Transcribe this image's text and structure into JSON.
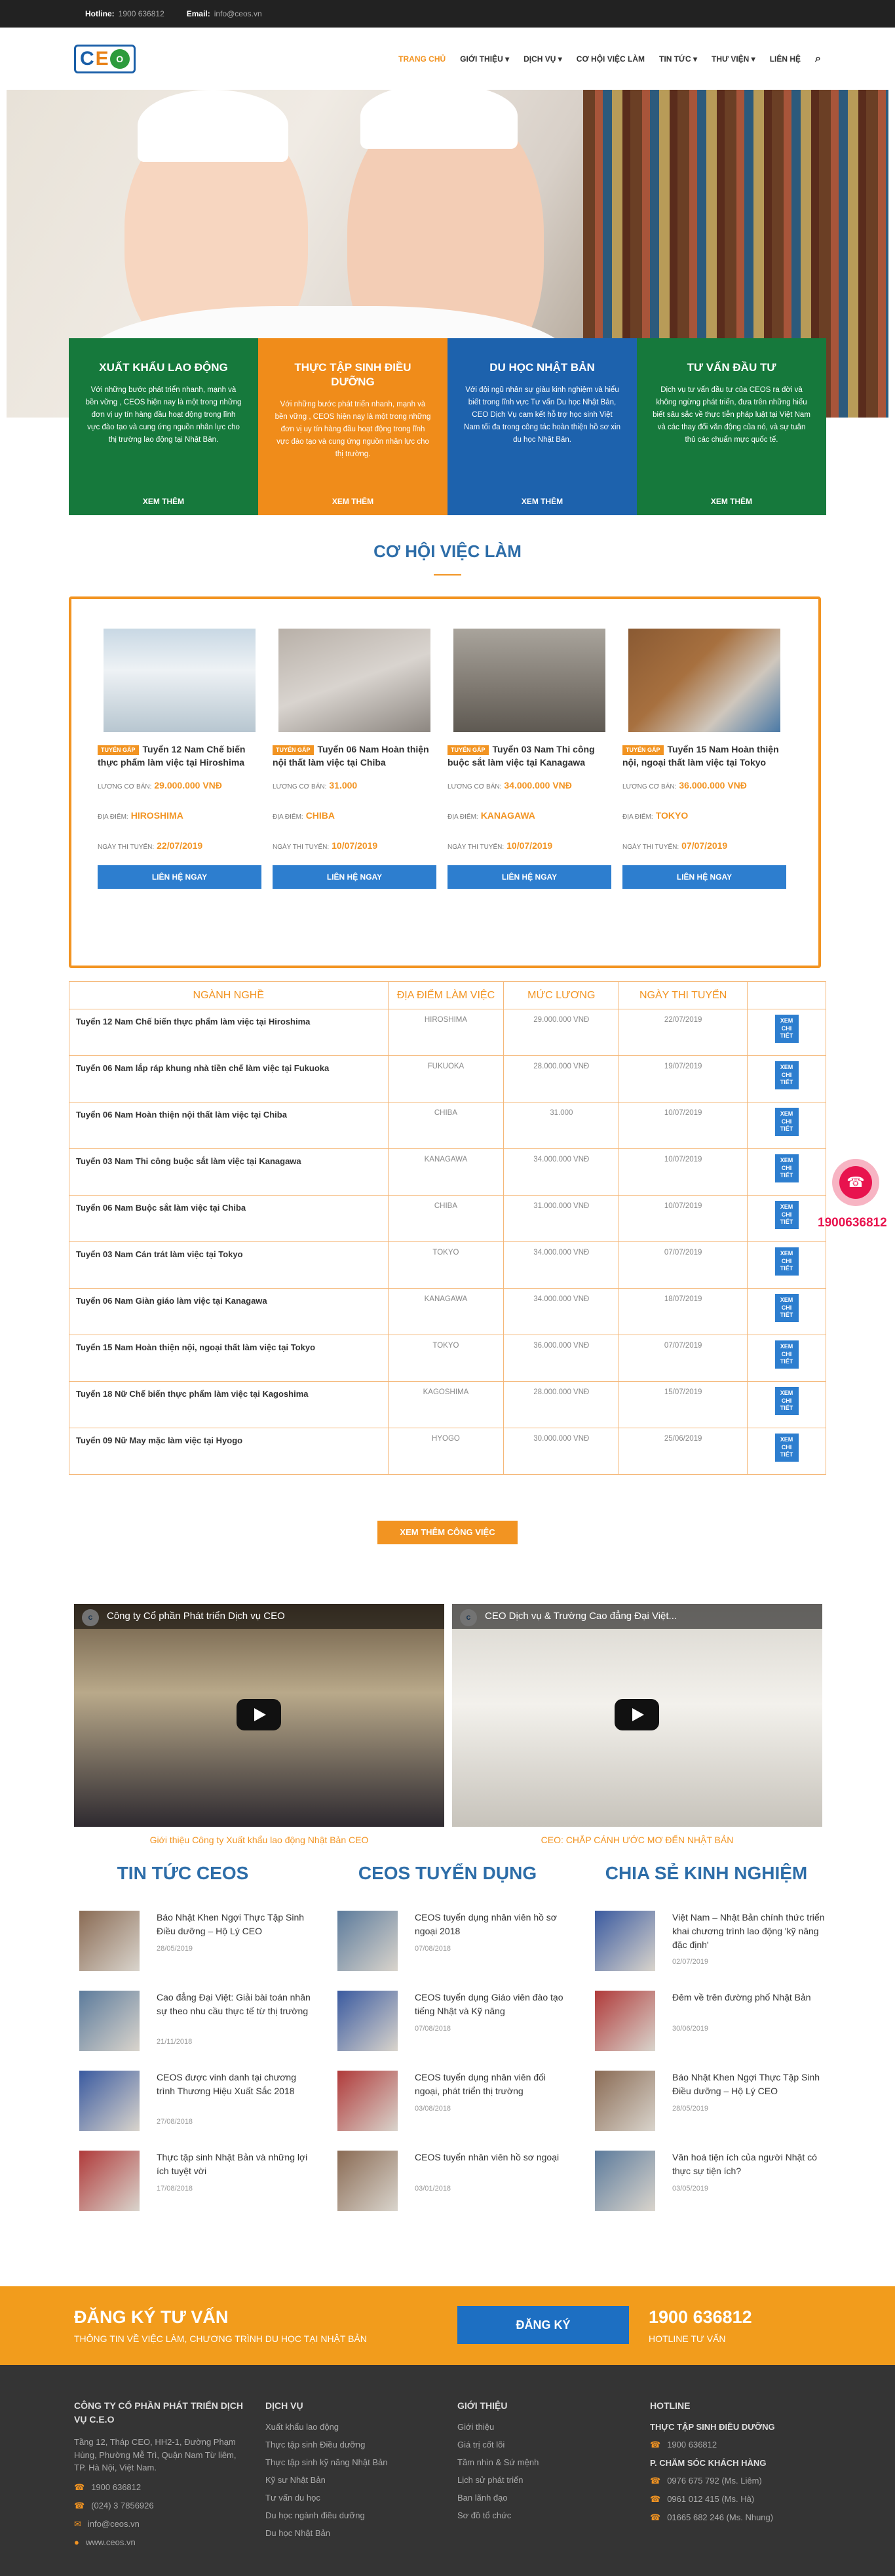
{
  "topbar": {
    "hotline_label": "Hotline:",
    "hotline": "1900 636812",
    "email_label": "Email:",
    "email": "info@ceos.vn"
  },
  "logo": {
    "text_left": "C",
    "text_mid": "E",
    "text_right": "O"
  },
  "nav": {
    "items": [
      "TRANG CHỦ",
      "GIỚI THIỆU ▾",
      "DỊCH VỤ ▾",
      "CƠ HỘI VIỆC LÀM",
      "TIN TỨC ▾",
      "THƯ VIỆN ▾",
      "LIÊN HỆ"
    ],
    "search_icon": "⌕"
  },
  "services": [
    {
      "title": "XUẤT KHẨU LAO ĐỘNG",
      "desc": "Với những bước phát triển nhanh, mạnh và bền vững , CEOS hiện nay là một trong những đơn vị uy tín hàng đầu hoạt động trong lĩnh vực đào tạo và cung ứng nguồn nhân lực cho thị trường lao động tại Nhật Bản.",
      "more": "XEM THÊM",
      "color": "#16793c"
    },
    {
      "title": "THỰC TẬP SINH ĐIỀU DƯỠNG",
      "desc": "Với những bước phát triển nhanh, mạnh và bền vững , CEOS hiện nay là một trong những đơn vị uy tín hàng đầu hoạt động trong lĩnh vực đào tạo và cung ứng nguồn nhân lực cho thị trường.",
      "more": "XEM THÊM",
      "color": "#f08c1a"
    },
    {
      "title": "DU HỌC NHẬT BẢN",
      "desc": "Với đội ngũ nhân sự giàu kinh nghiệm và hiểu biết trong lĩnh vực Tư vấn Du học Nhật Bản, CEO Dịch Vụ cam kết hỗ trợ học sinh Việt Nam tối đa trong công tác hoàn thiện hồ sơ xin du học Nhật Bản.",
      "more": "XEM THÊM",
      "color": "#1d62ad"
    },
    {
      "title": "TƯ VẤN ĐẦU TƯ",
      "desc": "Dịch vụ tư vấn đầu tư của CEOS ra đời và không ngừng phát triển, đưa trên những hiểu biết sâu sắc về thực tiễn pháp luật tại Việt Nam và các thay đổi văn động của nó, và sự tuân thủ các chuẩn mực quốc tế.",
      "more": "XEM THÊM",
      "color": "#16793c"
    }
  ],
  "jobs_section": {
    "title": "CƠ HỘI VIỆC LÀM"
  },
  "job_cards": [
    {
      "tag": "TUYỂN GẤP",
      "title": "Tuyển 12 Nam Chế biến thực phẩm làm việc tại Hiroshima",
      "salary_label": "LƯƠNG CƠ BẢN:",
      "salary": "29.000.000 VNĐ",
      "loc_label": "ĐỊA ĐIỂM:",
      "loc": "HIROSHIMA",
      "date_label": "NGÀY THI TUYỂN:",
      "date": "22/07/2019",
      "btn": "LIÊN HỆ NGAY"
    },
    {
      "tag": "TUYỂN GẤP",
      "title": "Tuyển 06 Nam Hoàn thiện nội thất làm việc tại Chiba",
      "salary_label": "LƯƠNG CƠ BẢN:",
      "salary": "31.000",
      "loc_label": "ĐỊA ĐIỂM:",
      "loc": "CHIBA",
      "date_label": "NGÀY THI TUYỂN:",
      "date": "10/07/2019",
      "btn": "LIÊN HỆ NGAY"
    },
    {
      "tag": "TUYỂN GẤP",
      "title": "Tuyển 03 Nam Thi công buộc sắt làm việc tại Kanagawa",
      "salary_label": "LƯƠNG CƠ BẢN:",
      "salary": "34.000.000 VNĐ",
      "loc_label": "ĐỊA ĐIỂM:",
      "loc": "KANAGAWA",
      "date_label": "NGÀY THI TUYỂN:",
      "date": "10/07/2019",
      "btn": "LIÊN HỆ NGAY"
    },
    {
      "tag": "TUYỂN GẤP",
      "title": "Tuyển 15 Nam Hoàn thiện nội, ngoại thất làm việc tại Tokyo",
      "salary_label": "LƯƠNG CƠ BẢN:",
      "salary": "36.000.000 VNĐ",
      "loc_label": "ĐỊA ĐIỂM:",
      "loc": "TOKYO",
      "date_label": "NGÀY THI TUYỂN:",
      "date": "07/07/2019",
      "btn": "LIÊN HỆ NGAY"
    }
  ],
  "job_table": {
    "headers": [
      "NGÀNH NGHỀ",
      "ĐỊA ĐIỂM LÀM VIỆC",
      "MỨC LƯƠNG",
      "NGÀY THI TUYỂN",
      ""
    ],
    "action_label": "XEM CHI TIẾT",
    "rows": [
      [
        "Tuyển 12 Nam Chế biến thực phẩm làm việc tại Hiroshima",
        "HIROSHIMA",
        "29.000.000 VNĐ",
        "22/07/2019"
      ],
      [
        "Tuyển 06 Nam lắp ráp khung nhà tiền chế làm việc tại Fukuoka",
        "FUKUOKA",
        "28.000.000 VNĐ",
        "19/07/2019"
      ],
      [
        "Tuyển 06 Nam Hoàn thiện nội thất làm việc tại Chiba",
        "CHIBA",
        "31.000",
        "10/07/2019"
      ],
      [
        "Tuyển 03 Nam Thi công buộc sắt làm việc tại Kanagawa",
        "KANAGAWA",
        "34.000.000 VNĐ",
        "10/07/2019"
      ],
      [
        "Tuyển 06 Nam Buộc sắt làm việc tại Chiba",
        "CHIBA",
        "31.000.000 VNĐ",
        "10/07/2019"
      ],
      [
        "Tuyển 03 Nam Cán trát làm việc tại Tokyo",
        "TOKYO",
        "34.000.000 VNĐ",
        "07/07/2019"
      ],
      [
        "Tuyển 06 Nam Giàn giáo làm việc tại Kanagawa",
        "KANAGAWA",
        "34.000.000 VNĐ",
        "18/07/2019"
      ],
      [
        "Tuyển 15 Nam Hoàn thiện nội, ngoại thất làm việc tại Tokyo",
        "TOKYO",
        "36.000.000 VNĐ",
        "07/07/2019"
      ],
      [
        "Tuyển 18 Nữ Chế biến thực phẩm làm việc tại Kagoshima",
        "KAGOSHIMA",
        "28.000.000 VNĐ",
        "15/07/2019"
      ],
      [
        "Tuyển 09 Nữ May mặc làm việc tại Hyogo",
        "HYOGO",
        "30.000.000 VNĐ",
        "25/06/2019"
      ]
    ]
  },
  "more_jobs": "XEM THÊM CÔNG VIỆC",
  "videos": [
    {
      "title": "Công ty Cổ phần Phát triển Dịch vụ CEO",
      "caption": "Giới thiệu Công ty Xuất khẩu lao động Nhật Bản CEO"
    },
    {
      "title": "CEO Dịch vụ & Trường Cao đẳng Đại Việt...",
      "caption": "CEO: CHẮP CÁNH ƯỚC MƠ ĐẾN NHẬT BẢN"
    }
  ],
  "news_cols": [
    {
      "title": "TIN TỨC CEOS",
      "items": [
        {
          "t": "Báo Nhật Khen Ngợi Thực Tập Sinh Điều dưỡng – Hộ Lý CEO",
          "d": "28/05/2019"
        },
        {
          "t": "Cao đẳng Đại Việt: Giải bài toán nhân sự theo nhu cầu thực tế từ thị trường",
          "d": "21/11/2018"
        },
        {
          "t": "CEOS được vinh danh tại chương trình Thương Hiệu Xuất Sắc 2018",
          "d": "27/08/2018"
        },
        {
          "t": "Thực tập sinh Nhật Bản và những lợi ích tuyệt vời",
          "d": "17/08/2018"
        }
      ]
    },
    {
      "title": "CEOS TUYỂN DỤNG",
      "items": [
        {
          "t": "CEOS tuyển dụng nhân viên hồ sơ ngoại 2018",
          "d": "07/08/2018"
        },
        {
          "t": "CEOS tuyển dụng Giáo viên đào tạo tiếng Nhật và Kỹ năng",
          "d": "07/08/2018"
        },
        {
          "t": "CEOS tuyển dụng nhân viên đối ngoại, phát triển thị trường",
          "d": "03/08/2018"
        },
        {
          "t": "CEOS tuyển nhân viên hồ sơ ngoại",
          "d": "03/01/2018"
        }
      ]
    },
    {
      "title": "CHIA SẺ KINH NGHIỆM",
      "items": [
        {
          "t": "Việt Nam – Nhật Bản chính thức triển khai chương trình lao động 'kỹ năng đặc định'",
          "d": "02/07/2019"
        },
        {
          "t": "Đêm về trên đường phố Nhật Bản",
          "d": "30/06/2019"
        },
        {
          "t": "Báo Nhật Khen Ngợi Thực Tập Sinh Điều dưỡng – Hộ Lý CEO",
          "d": "28/05/2019"
        },
        {
          "t": "Văn hoá tiện ích của người Nhật có thực sự tiện ích?",
          "d": "03/05/2019"
        }
      ]
    }
  ],
  "cta": {
    "title": "ĐĂNG KÝ TƯ VẤN",
    "sub": "THÔNG TIN VỀ VIỆC LÀM, CHƯƠNG TRÌNH DU HỌC TẠI NHẬT BẢN",
    "button": "ĐĂNG KÝ",
    "phone": "1900 636812",
    "phone_label": "HOTLINE TƯ VẤN"
  },
  "footer": {
    "company": {
      "title": "CÔNG TY CỔ PHẦN PHÁT TRIỂN DỊCH VỤ C.E.O",
      "address": "Tầng 12, Tháp CEO, HH2-1, Đường Phạm Hùng, Phường Mễ Trì, Quận Nam Từ liêm, TP. Hà Nội, Việt Nam.",
      "phone1": "1900 636812",
      "phone2": "(024) 3 7856926",
      "email": "info@ceos.vn",
      "web": "www.ceos.vn"
    },
    "services": {
      "title": "DỊCH VỤ",
      "items": [
        "Xuất khẩu lao động",
        "Thực tập sinh Điều dưỡng",
        "Thực tập sinh kỹ năng Nhật Bản",
        "Kỹ sư Nhật Bản",
        "Tư vấn du học",
        "Du học ngành điều dưỡng",
        "Du học Nhật Bản"
      ]
    },
    "about": {
      "title": "GIỚI THIỆU",
      "items": [
        "Giới thiệu",
        "Giá trị cốt lõi",
        "Tầm nhìn & Sứ mệnh",
        "Lịch sử phát triển",
        "Ban lãnh đạo",
        "Sơ đồ tổ chức"
      ]
    },
    "hotline": {
      "title": "HOTLINE",
      "sub1": "THỰC TẬP SINH ĐIỀU DƯỠNG",
      "p1": "1900 636812",
      "sub2": "P. CHĂM SÓC KHÁCH HÀNG",
      "p2": "0976 675 792 (Ms. Liêm)",
      "p3": "0961 012 415 (Ms. Hà)",
      "p4": "01665 682 246 (Ms. Nhung)"
    }
  },
  "float": {
    "phone": "1900636812",
    "icon": "☎"
  }
}
